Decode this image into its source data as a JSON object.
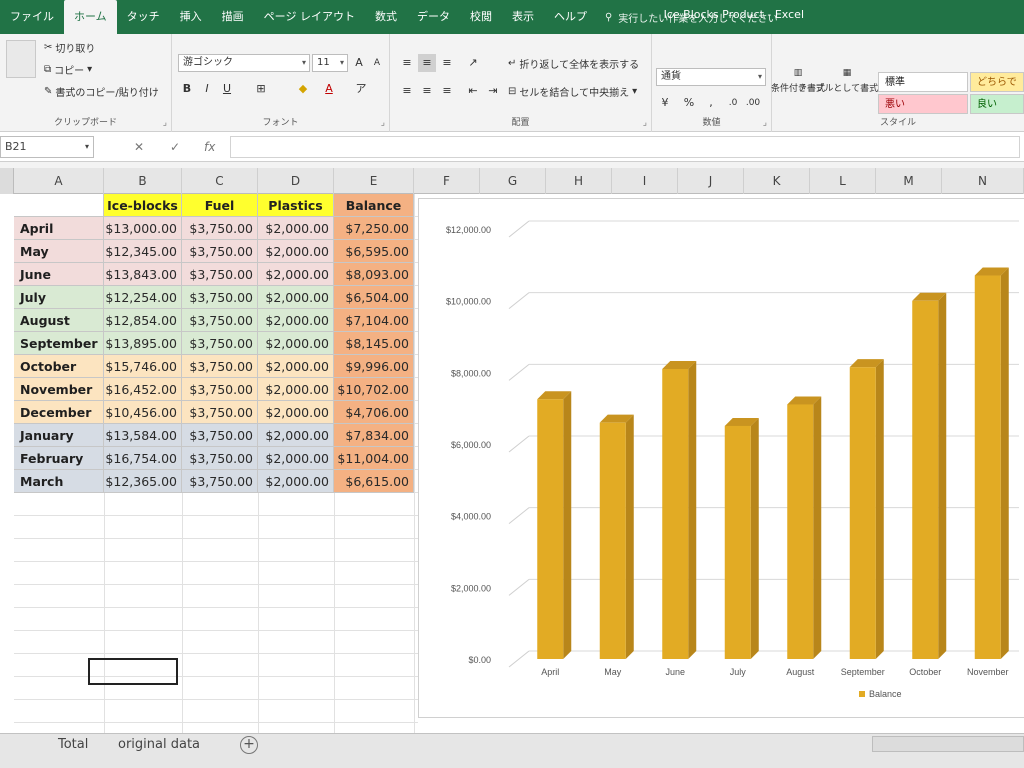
{
  "ribbon_tabs": [
    "ファイル",
    "ホーム",
    "タッチ",
    "挿入",
    "描画",
    "ページ レイアウト",
    "数式",
    "データ",
    "校閲",
    "表示",
    "ヘルプ"
  ],
  "active_tab_index": 1,
  "tell_me": "実行したい作業を入力してください",
  "window_title": "Ice Blocks Product  -  Excel",
  "clipboard": {
    "cut": "切り取り",
    "copy": "コピー",
    "format_painter": "書式のコピー/貼り付け",
    "label": "クリップボード"
  },
  "font": {
    "name": "游ゴシック",
    "size": "11",
    "bold": "B",
    "italic": "I",
    "underline": "U",
    "label": "フォント"
  },
  "alignment": {
    "wrap": "折り返して全体を表示する",
    "merge": "セルを結合して中央揃え",
    "label": "配置"
  },
  "number": {
    "format": "通貨",
    "percent": "%",
    "label": "数値"
  },
  "styles": {
    "cond_format": "条件付き書式",
    "table_format": "テーブルとして書式設定",
    "normal": "標準",
    "bad": "悪い",
    "good": "良い",
    "neutral": "どちらで",
    "label": "スタイル"
  },
  "name_box": "B21",
  "fx": "fx",
  "columns": [
    "A",
    "B",
    "C",
    "D",
    "E",
    "F",
    "G",
    "H",
    "I",
    "J",
    "K",
    "L",
    "M",
    "N"
  ],
  "table": {
    "headers": [
      "Ice-blocks",
      "Fuel",
      "Plastics",
      "Balance"
    ],
    "rows": [
      {
        "month": "April",
        "ice": "$13,000.00",
        "fuel": "$3,750.00",
        "plastics": "$2,000.00",
        "balance": "$7,250.00"
      },
      {
        "month": "May",
        "ice": "$12,345.00",
        "fuel": "$3,750.00",
        "plastics": "$2,000.00",
        "balance": "$6,595.00"
      },
      {
        "month": "June",
        "ice": "$13,843.00",
        "fuel": "$3,750.00",
        "plastics": "$2,000.00",
        "balance": "$8,093.00"
      },
      {
        "month": "July",
        "ice": "$12,254.00",
        "fuel": "$3,750.00",
        "plastics": "$2,000.00",
        "balance": "$6,504.00"
      },
      {
        "month": "August",
        "ice": "$12,854.00",
        "fuel": "$3,750.00",
        "plastics": "$2,000.00",
        "balance": "$7,104.00"
      },
      {
        "month": "September",
        "ice": "$13,895.00",
        "fuel": "$3,750.00",
        "plastics": "$2,000.00",
        "balance": "$8,145.00"
      },
      {
        "month": "October",
        "ice": "$15,746.00",
        "fuel": "$3,750.00",
        "plastics": "$2,000.00",
        "balance": "$9,996.00"
      },
      {
        "month": "November",
        "ice": "$16,452.00",
        "fuel": "$3,750.00",
        "plastics": "$2,000.00",
        "balance": "$10,702.00"
      },
      {
        "month": "December",
        "ice": "$10,456.00",
        "fuel": "$3,750.00",
        "plastics": "$2,000.00",
        "balance": "$4,706.00"
      },
      {
        "month": "January",
        "ice": "$13,584.00",
        "fuel": "$3,750.00",
        "plastics": "$2,000.00",
        "balance": "$7,834.00"
      },
      {
        "month": "February",
        "ice": "$16,754.00",
        "fuel": "$3,750.00",
        "plastics": "$2,000.00",
        "balance": "$11,004.00"
      },
      {
        "month": "March",
        "ice": "$12,365.00",
        "fuel": "$3,750.00",
        "plastics": "$2,000.00",
        "balance": "$6,615.00"
      }
    ],
    "row_colors": [
      "#f2dcdb",
      "#f2dcdb",
      "#f2dcdb",
      "#d9ead3",
      "#d9ead3",
      "#d9ead3",
      "#fce4c0",
      "#fce4c0",
      "#fce4c0",
      "#d6dce4",
      "#d6dce4",
      "#d6dce4"
    ]
  },
  "chart_data": {
    "type": "bar",
    "categories": [
      "April",
      "May",
      "June",
      "July",
      "August",
      "September",
      "October",
      "November"
    ],
    "series": [
      {
        "name": "Balance",
        "values": [
          7250,
          6595,
          8093,
          6504,
          7104,
          8145,
          9996,
          10702
        ]
      }
    ],
    "ylim": [
      0,
      12000
    ],
    "yticks": [
      "$0.00",
      "$2,000.00",
      "$4,000.00",
      "$6,000.00",
      "$8,000.00",
      "$10,000.00",
      "$12,000.00"
    ],
    "bar_color": "#e2ab24",
    "legend_position": "bottom",
    "grid": true
  },
  "sheets": [
    "Total",
    "original data"
  ],
  "active_sheet": 0,
  "colors": {
    "accent": "#217346"
  }
}
